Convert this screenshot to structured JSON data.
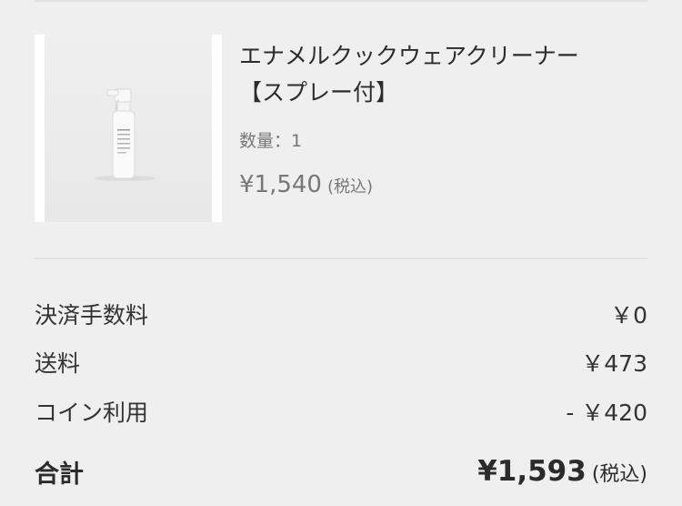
{
  "product": {
    "name_line1": "エナメルクックウェアクリーナー",
    "name_line2": "【スプレー付】",
    "quantity": "数量：1",
    "price": "¥1,540",
    "tax_note": "(税込)",
    "image_icon": "spray-bottle-icon"
  },
  "summary": {
    "fee_label": "決済手数料",
    "fee_value": "￥0",
    "shipping_label": "送料",
    "shipping_value": "￥473",
    "coin_label": "コイン利用",
    "coin_value": "- ￥420",
    "total_label": "合計",
    "total_value": "¥1,593",
    "total_tax_note": "(税込)"
  },
  "colors": {
    "background": "#efefef",
    "divider": "#e2e2e2",
    "text": "#333333",
    "muted": "#777777"
  }
}
